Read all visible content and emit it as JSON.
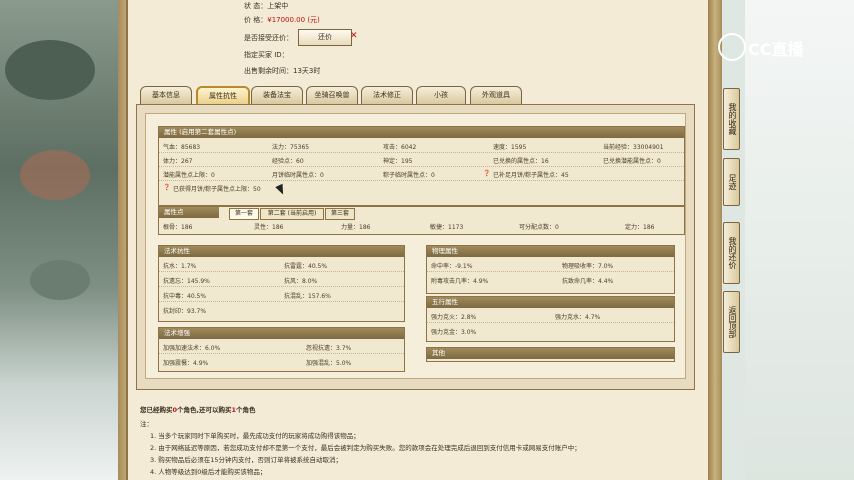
{
  "listing": {
    "status_label": "状        态：",
    "status_value": "上架中",
    "price_label": "价        格：",
    "price_value": "¥17000.00 (元)",
    "counter_label": "是否接受还价：",
    "counter_button": "还价",
    "buyer_label": "指定买家 ID：",
    "time_label": "出售剩余时间：",
    "time_value": "13天3时"
  },
  "tabs": [
    "基本信息",
    "属性抗性",
    "装备法宝",
    "坐骑召唤兽",
    "法术修正",
    "小孩",
    "外观道具"
  ],
  "active_tab": 1,
  "attributes": {
    "header": "属性 (启用第二套属性点)",
    "rows": [
      [
        "气血：85683",
        "法力：75365",
        "攻击：6042",
        "速度：1595",
        "当前经验：33004901"
      ],
      [
        "体力：267",
        "经验点：60",
        "神定：195",
        "已兑换的属性点：16",
        "已兑换潜能属性点：0"
      ],
      [
        "潜能属性点上限：0",
        "月饼临时属性点：0",
        "粽子临时属性点：0",
        "已补足月饼/粽子属性点：45",
        ""
      ]
    ],
    "extra": "已获得月饼/粽子属性点上限：50"
  },
  "points": {
    "header": "属性点",
    "subtabs": [
      "第一套",
      "第二套 (当前启用)",
      "第三套"
    ],
    "values": [
      "根骨：186",
      "灵性：186",
      "力量：186",
      "敏捷：1173",
      "可分配点数：0",
      "定力：186"
    ]
  },
  "resist": {
    "header": "法术抗性",
    "rows": [
      [
        "抗水：1.7%",
        "抗雷霆：40.5%"
      ],
      [
        "抗遗忘：145.9%",
        "抗风：8.0%"
      ],
      [
        "抗中毒：40.5%",
        "抗混乱：157.6%"
      ],
      [
        "抗封印：93.7%",
        ""
      ]
    ]
  },
  "enhance": {
    "header": "法术增强",
    "rows": [
      [
        "加强加速法术：6.0%",
        "忽视抗遗：3.7%"
      ],
      [
        "加强震慑：4.9%",
        "加强混乱：5.0%"
      ]
    ]
  },
  "physical": {
    "header": "物理属性",
    "rows": [
      [
        "命中率：-9.1%",
        "物理吸收率：7.0%"
      ],
      [
        "附毒攻击几率：4.9%",
        "抗致命几率：4.4%"
      ]
    ]
  },
  "wuxing": {
    "header": "五行属性",
    "rows": [
      [
        "强力克火：2.8%",
        "强力克水：4.7%"
      ],
      [
        "强力克金：3.0%",
        ""
      ]
    ]
  },
  "other": {
    "header": "其他"
  },
  "notes": {
    "summary_prefix": "您已经购买",
    "bought": "0",
    "summary_mid": "个角色,还可以购买",
    "remain": "1",
    "summary_suffix": "个角色",
    "title": "注：",
    "lines": [
      "1. 当多个玩家同时下单购买时，最先成功支付的玩家将成功购得该物品；",
      "2. 由于网络延迟等原因，若您成功支付却不是第一个支付，最后会被判定为购买失败。您的款项会在处理完成后退回到支付信用卡或网易支付账户中；",
      "3. 购买物品后必须在15分钟内支付，否则订单将被系统自动取消；",
      "4. 人物等级达到0级后才能购买该物品；"
    ]
  },
  "sidebar": [
    "我的收藏",
    "足迹",
    "我的还价",
    "返回顶部"
  ],
  "logo_text": "CC直播"
}
